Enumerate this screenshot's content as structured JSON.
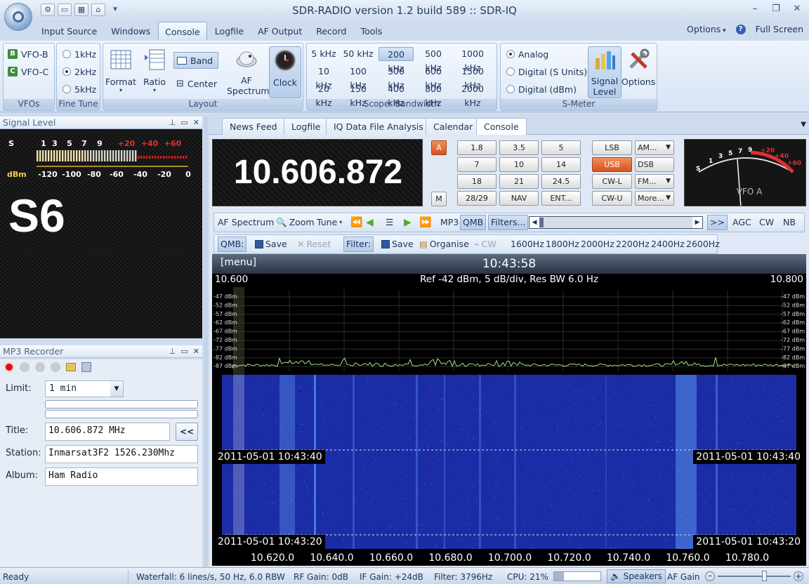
{
  "window": {
    "title": "SDR-RADIO version 1.2  build 589 :: SDR-IQ"
  },
  "menu": {
    "tabs": [
      "Input Source",
      "Windows",
      "Console",
      "Logfile",
      "AF Output",
      "Record",
      "Tools"
    ],
    "active": "Console",
    "options": "Options",
    "fullscreen": "Full Screen"
  },
  "ribbon": {
    "vfos": {
      "items": [
        "VFO-B",
        "VFO-C"
      ],
      "icons": [
        "B",
        "C"
      ],
      "label": "VFOs"
    },
    "finetune": {
      "items": [
        "1kHz",
        "2kHz",
        "5kHz"
      ],
      "selected": "2kHz",
      "label": "Fine Tune"
    },
    "layout": {
      "format": "Format",
      "ratio": "Ratio",
      "band": "Band",
      "center": "Center",
      "af_spectrum_1": "AF",
      "af_spectrum_2": "Spectrum",
      "clock": "Clock",
      "label": "Layout"
    },
    "bandwidth": {
      "rows": [
        [
          "5 kHz",
          "50 kHz",
          "200 kHz",
          "500 kHz",
          "1000 kHz"
        ],
        [
          "10 kHz",
          "100 kHz",
          "300 kHz",
          "600 kHz",
          "1500 kHz"
        ],
        [
          "20 kHz",
          "150 kHz",
          "400 kHz",
          "800 kHz",
          "2000 kHz"
        ]
      ],
      "selected": "200 kHz",
      "label": "Scope: Bandwidth"
    },
    "smeter": {
      "items": [
        "Analog",
        "Digital (S Units)",
        "Digital (dBm)"
      ],
      "selected": "Analog",
      "signal_1": "Signal",
      "signal_2": "Level",
      "options": "Options",
      "label": "S-Meter"
    }
  },
  "signal_panel": {
    "title": "Signal Level",
    "s_label": "S",
    "dbm_label": "dBm",
    "s_ticks": [
      "1",
      "3",
      "5",
      "7",
      "9"
    ],
    "plus_ticks": [
      "+20",
      "+40",
      "+60"
    ],
    "dbm_ticks": [
      "-120",
      "-100",
      "-80",
      "-60",
      "-40",
      "-20",
      "0"
    ],
    "reading": "S6",
    "level_fraction": 0.34
  },
  "mp3": {
    "title": "MP3 Recorder",
    "limit_label": "Limit:",
    "limit_value": "1 min",
    "title_label": "Title:",
    "title_value": "10.606.872 MHz",
    "station_label": "Station:",
    "station_value": "Inmarsat3F2 1526.230Mhz",
    "album_label": "Album:",
    "album_value": "Ham Radio",
    "back_button": "<<"
  },
  "doc_tabs": [
    "News Feed",
    "Logfile",
    "IQ Data File Analysis",
    "Calendar",
    "Console"
  ],
  "doc_tab_active": "Console",
  "console": {
    "frequency": "10.606.872",
    "a_button": "A",
    "m_button": "M",
    "keypad": [
      [
        "1.8",
        "3.5",
        "5"
      ],
      [
        "7",
        "10",
        "14"
      ],
      [
        "18",
        "21",
        "24.5"
      ],
      [
        "28/29",
        "NAV",
        "ENT..."
      ]
    ],
    "modes": [
      [
        "LSB",
        "AM..."
      ],
      [
        "USB",
        "DSB"
      ],
      [
        "CW-L",
        "FM..."
      ],
      [
        "CW-U",
        "More..."
      ]
    ],
    "active_mode": "USB",
    "smeter_ticks": [
      "S",
      "1",
      "3",
      "5",
      "7",
      "9",
      "+20",
      "+40",
      "+60"
    ],
    "smeter_label": "VFO A"
  },
  "toolbar1": {
    "items": [
      "AF Spectrum",
      "Zoom",
      "Tune",
      "MP3",
      "QMB",
      "Filters...",
      ">>",
      "AGC",
      "CW",
      "NB"
    ]
  },
  "toolbar2": {
    "qmb": "QMB:",
    "save": "Save",
    "reset": "Reset",
    "filter": "Filter:",
    "save2": "Save",
    "organise": "Organise",
    "cw": "CW",
    "filters": [
      "1600Hz",
      "1800Hz",
      "2000Hz",
      "2200Hz",
      "2400Hz",
      "2600Hz"
    ]
  },
  "spectrum": {
    "menu": "[menu]",
    "clock": "10:43:58",
    "start": "10.600",
    "end": "10.800",
    "info": "Ref -42 dBm,  5 dB/div,  Res BW 6.0 Hz",
    "dbm_labels": [
      "-47 dBm",
      "-52 dBm",
      "-57 dBm",
      "-62 dBm",
      "-67 dBm",
      "-72 dBm",
      "-77 dBm",
      "-82 dBm",
      "-87 dBm"
    ],
    "freq_labels": [
      "10.620.0",
      "10.640.0",
      "10.660.0",
      "10.680.0",
      "10.700.0",
      "10.720.0",
      "10.740.0",
      "10.760.0",
      "10.780.0"
    ],
    "ts1": "2011-05-01  10:43:40",
    "ts2": "2011-05-01  10:43:20"
  },
  "status": {
    "ready": "Ready",
    "waterfall": "Waterfall: 6 lines/s, 50 Hz, 6.0 RBW",
    "rf_gain": "RF Gain: 0dB",
    "if_gain": "IF Gain: +24dB",
    "filter": "Filter: 3796Hz",
    "cpu": "CPU: 21%",
    "speakers": "Speakers",
    "af_gain": "AF Gain"
  },
  "colors": {
    "accent": "#2f63b4",
    "active_mode": "#d8501f",
    "waterfall_bg": "#1b2fa0",
    "trace": "#a6e07a"
  }
}
